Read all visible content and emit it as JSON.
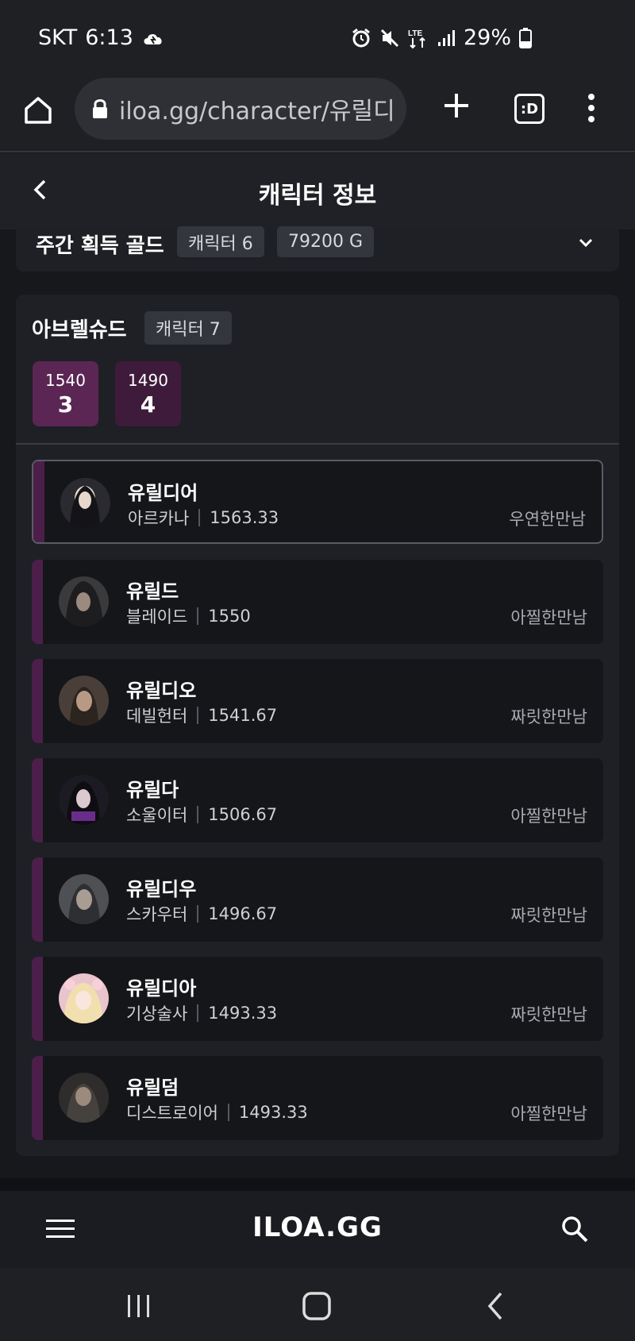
{
  "status": {
    "carrier": "SKT",
    "time": "6:13",
    "battery": "29%"
  },
  "browser": {
    "url": "iloa.gg/character/유릴디",
    "tabs_label": ":D"
  },
  "header": {
    "title": "캐릭터 정보"
  },
  "gold": {
    "label": "주간 획득 골드",
    "char_badge": "캐릭터 6",
    "gold_badge": "79200 G"
  },
  "server": {
    "name": "아브렐슈드",
    "badge": "캐릭터 7",
    "levels": [
      {
        "level": "1540",
        "count": "3",
        "color": "#5b2653"
      },
      {
        "level": "1490",
        "count": "4",
        "color": "#3f1b3b"
      }
    ],
    "characters": [
      {
        "name": "유릴디어",
        "class": "아르카나",
        "ilvl": "1563.33",
        "guild": "우연한만남",
        "selected": true
      },
      {
        "name": "유릴드",
        "class": "블레이드",
        "ilvl": "1550",
        "guild": "아찔한만남"
      },
      {
        "name": "유릴디오",
        "class": "데빌헌터",
        "ilvl": "1541.67",
        "guild": "짜릿한만남"
      },
      {
        "name": "유릴다",
        "class": "소울이터",
        "ilvl": "1506.67",
        "guild": "아찔한만남"
      },
      {
        "name": "유릴디우",
        "class": "스카우터",
        "ilvl": "1496.67",
        "guild": "짜릿한만남"
      },
      {
        "name": "유릴디아",
        "class": "기상술사",
        "ilvl": "1493.33",
        "guild": "짜릿한만남"
      },
      {
        "name": "유릴덤",
        "class": "디스트로이어",
        "ilvl": "1493.33",
        "guild": "아찔한만남"
      }
    ]
  },
  "footer": {
    "logo": "ILOA.GG"
  }
}
